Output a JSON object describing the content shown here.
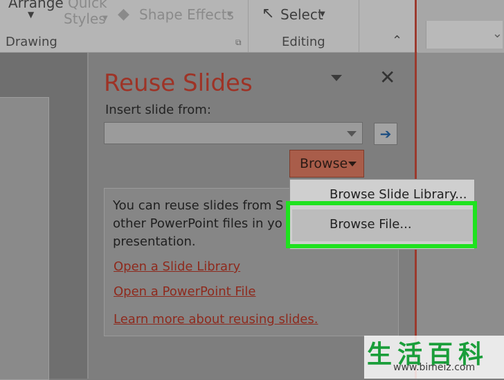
{
  "ribbon": {
    "arrange_label": "Arrange",
    "quick_label": "Quick",
    "styles_label": "Styles",
    "shape_effects_label": "Shape Effects",
    "select_label": "Select",
    "drawing_group": "Drawing",
    "editing_group": "Editing"
  },
  "reuse_pane": {
    "title": "Reuse Slides",
    "insert_label": "Insert slide from:",
    "insert_value": "",
    "browse_label": "Browse",
    "info_line1": "You can reuse slides from S",
    "info_line2": "other PowerPoint files in yo",
    "info_line3": "presentation.",
    "link_slide_library": "Open a Slide Library",
    "link_powerpoint_file": "Open a PowerPoint File",
    "link_learn_more": "Learn more about reusing slides."
  },
  "browse_menu": {
    "items": [
      "Browse Slide Library...",
      "Browse File..."
    ],
    "highlighted": "Browse File..."
  },
  "watermark": {
    "chinese": "生活百科",
    "url": "www.bimeiz.com"
  },
  "colors": {
    "title": "#9e3326",
    "browse_button": "#a95d4a",
    "highlight_outline": "#1fe21f",
    "link": "#8e2a1d"
  }
}
